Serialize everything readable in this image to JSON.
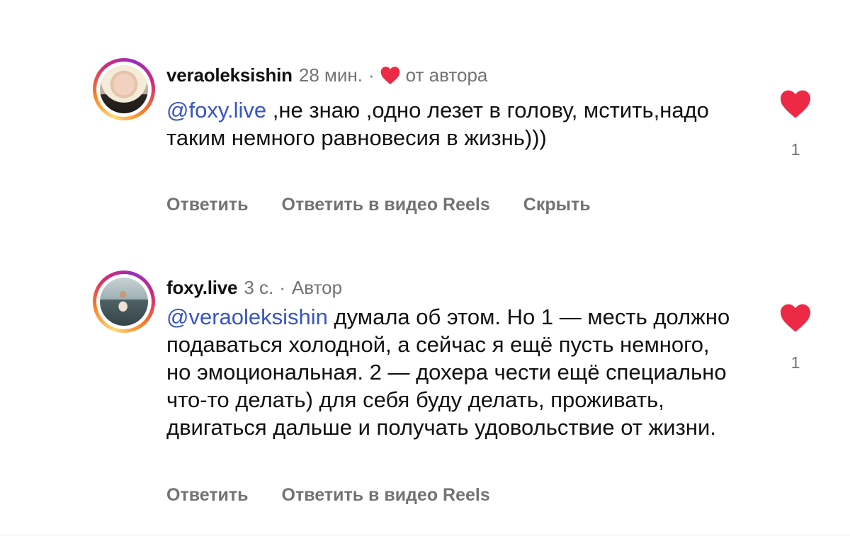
{
  "comments": [
    {
      "username": "veraoleksishin",
      "time": "28 мин.",
      "separator": "·",
      "badge": "от автора",
      "badge_icon": "heart-icon",
      "mention": "@foxy.live",
      "text": " ,не знаю ,одно лезет в голову, мстить,надо таким немного равновесия в жизнь)))",
      "actions": [
        "Ответить",
        "Ответить в видео Reels",
        "Скрыть"
      ],
      "likes": "1",
      "liked": true
    },
    {
      "username": "foxy.live",
      "time": "3 с.",
      "separator": "·",
      "badge": "Автор",
      "mention": "@veraoleksishin",
      "text": " думала об этом. Но 1 — месть должно подаваться холодной, а сейчас я ещё пусть немного, но эмоциональная. 2 — дохера чести ещё специально что-то делать) для себя буду делать, проживать, двигаться дальше и получать удовольствие от жизни.",
      "actions": [
        "Ответить",
        "Ответить в видео Reels"
      ],
      "likes": "1",
      "liked": true
    }
  ],
  "colors": {
    "heart": "#ed2a45",
    "mention": "#3754c7",
    "secondary_text": "#737373"
  }
}
